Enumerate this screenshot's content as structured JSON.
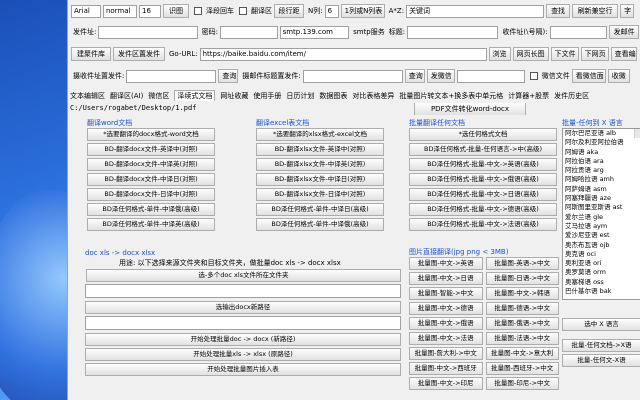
{
  "toolbar1": {
    "font": "Arial",
    "style": "normal",
    "size": "16",
    "buttons": [
      "识图",
      "段行距",
      "查找",
      "刷新兼空行",
      "字"
    ],
    "check1": "泽段回车",
    "check2": "翻译区",
    "nlabel": "N列:",
    "nval": "6",
    "cols_btn": "1列或N列表",
    "az_label": "A*Z:",
    "keyword": "关键词"
  },
  "toolbar2": {
    "from_label": "发件址:",
    "pwd_label": "密码:",
    "smtp_value": "smtp.139.com",
    "smtp_label": "smtp服务",
    "title_label": "标题:",
    "recv_label": "收件址(\\号隔):",
    "send_btn": "发邮件"
  },
  "toolbar3": {
    "buttons": [
      "建聚件库",
      "发件区置发件"
    ],
    "url_label": "Go-URL:",
    "url": "https://baike.baidu.com/item/",
    "right_buttons": [
      "浏览",
      "网页长图",
      "下文件",
      "下网页",
      "查看编"
    ]
  },
  "toolbar4": {
    "label1": "摄收件址置发件:",
    "btn1": "查询",
    "label2": "摄邮件标题置发件:",
    "btn2": "查询",
    "btn3": "发微信",
    "check": "微信文件",
    "btn4": "看微信面",
    "btn5": "收微"
  },
  "tabs": [
    "文本编辑区",
    "翻译区(AI)",
    "微信区",
    "泽续式文档",
    "网址收藏",
    "使用手册",
    "日历计划",
    "数据图表",
    "对比表格差异",
    "批量图片转文本+换多表中单元格",
    "计算器+股票",
    "发件历史区"
  ],
  "active_tab": 3,
  "path": "C:/Users/rogabet/Desktop/1.pdf",
  "pdf_btn": "PDF文件转化word-docx",
  "word": {
    "title": "翻译word文档",
    "buttons": [
      "*选要翻译的docx格式-word文档",
      "BD-翻译docx文件-英译中(对照)",
      "BD-翻译docx文件-中译英(对照)",
      "BD-翻译docx文件-中译日(对照)",
      "BD-翻译docx文件-日译中(对照)",
      "BD泽任何格式-单件-中译俄(高级)",
      "BD泽任何格式-单件-中译英(高级)"
    ]
  },
  "excel": {
    "title": "翻译excel表文档",
    "buttons": [
      "*选要翻译的xlsx格式-excel文档",
      "BD-翻译xlsx文件-英译中(对照)",
      "BD-翻译xlsx文件-中译英(对照)",
      "BD-翻译xlsx文件-中译日(对照)",
      "BD-翻译xlsx文件-日译中(对照)",
      "BD泽任何格式-单件-中译日(高级)",
      "BD泽任何格式-单件-中译俄(高级)"
    ]
  },
  "batch": {
    "title": "批量翻译任何文档",
    "buttons": [
      "*选任何格式文档",
      "BD泽任何格式-批量-任何语言->中(高级)",
      "BD泽任何格式-批量-中文->英语(高级)",
      "BD泽任何格式-批量-中文->俄语(高级)",
      "BD泽任何格式-批量-中文->日语(高级)",
      "BD泽任何格式-批量-中文->德语(高级)",
      "BD泽任何格式-批量-中文->法语(高级)"
    ]
  },
  "convert": {
    "title": "doc xls -> docx xlsx",
    "note": "用途: 以下选择来源文件夹和目标文件夹，做批量doc xls -> docx xlsx",
    "btn_select": "选-多个doc xls文件所在文件夹",
    "btn_target": "选输出docx新路径",
    "btn_doc": "开始处理批量doc -> docx (新路径)",
    "btn_xls": "开始处理批量xls -> xlsx (原路径)",
    "btn_img": "开始处理批量图片插入表"
  },
  "imgtrans": {
    "title": "图片直接翻译(jpg png < 3MB)",
    "buttons": [
      "批量图-中文->英语",
      "批量图-英语->中文",
      "批量图-中文->日语",
      "批量图-日语->中文",
      "批量图-智能->中文",
      "批量图-中文->韩语",
      "批量图-中文->德语",
      "批量图-德语->中文",
      "批量图-中文->俄语",
      "批量图-俄语->中文",
      "批量图-中文->法语",
      "批量图-法语->中文",
      "批量图-詹大利->中文",
      "批量图-中文->意大利",
      "批量图-中文->西班牙",
      "批量图-西班牙->中文",
      "批量图-中文->印尼",
      "批量图-印尼->中文"
    ]
  },
  "langs": {
    "title": "批量-任何到 X 语言",
    "items": [
      "阿尔巴尼亚语 alb",
      "阿尔及利亚阿拉伯语",
      "阿姆语 aka",
      "阿拉伯语 ara",
      "阿拉贡语 arg",
      "阿姆哈拉语 amh",
      "阿萨姆语 asm",
      "阿塞拜疆语 aze",
      "阿斯图里亚斯语 ast",
      "爱尔兰语 gle",
      "艾马拉语 aym",
      "爱沙尼亚语 est",
      "奥杰布瓦语 ojb",
      "奥克语 oci",
      "奥利亚语 ori",
      "奥罗莫语 orm",
      "奥塞梯语 oss",
      "巴什基尔语 bak"
    ],
    "selected": "选中 X 语言",
    "bottom_btns": [
      "批量-任何文档->X语",
      "批量-任何文-X语"
    ]
  }
}
